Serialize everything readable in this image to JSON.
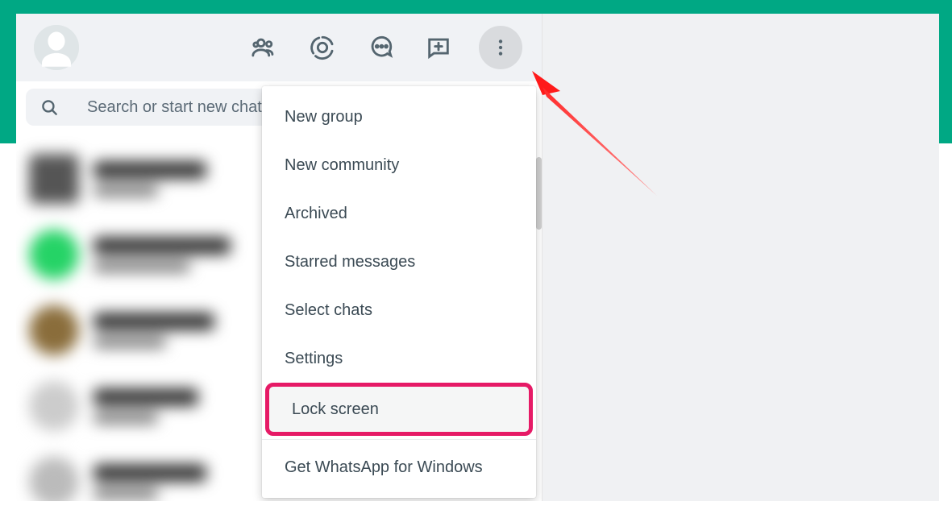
{
  "search": {
    "placeholder": "Search or start new chat"
  },
  "icons": {
    "communities": "communities-icon",
    "status": "status-icon",
    "new_chat": "new-chat-icon",
    "channels": "channels-icon",
    "menu": "menu-icon"
  },
  "menu": {
    "items": [
      {
        "label": "New group"
      },
      {
        "label": "New community"
      },
      {
        "label": "Archived"
      },
      {
        "label": "Starred messages"
      },
      {
        "label": "Select chats"
      },
      {
        "label": "Settings"
      },
      {
        "label": "Lock screen"
      }
    ],
    "footer": {
      "label": "Get WhatsApp for Windows"
    }
  },
  "annotation": {
    "highlighted_item_index": 6,
    "arrow_points_to": "menu-button"
  },
  "colors": {
    "brand": "#00a884",
    "highlight": "#e61a66"
  }
}
